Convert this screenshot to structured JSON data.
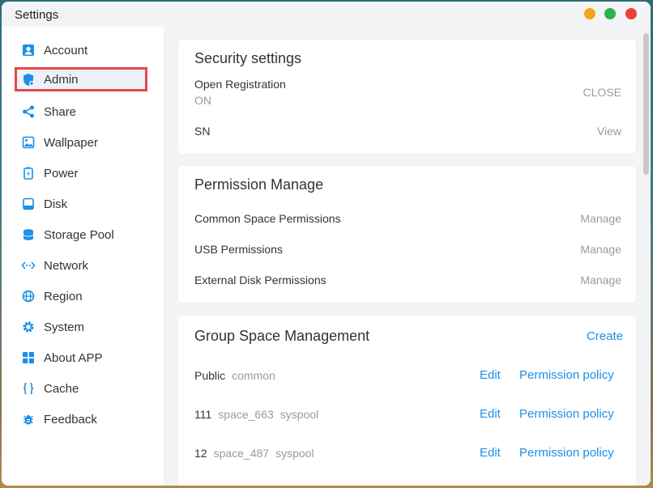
{
  "window": {
    "title": "Settings"
  },
  "accent_color": "#1a8fe6",
  "sidebar": {
    "items": [
      {
        "label": "Account",
        "icon": "account-icon"
      },
      {
        "label": "Admin",
        "icon": "admin-shield-icon",
        "active": true
      },
      {
        "label": "Share",
        "icon": "share-icon"
      },
      {
        "label": "Wallpaper",
        "icon": "wallpaper-icon"
      },
      {
        "label": "Power",
        "icon": "power-icon"
      },
      {
        "label": "Disk",
        "icon": "disk-icon"
      },
      {
        "label": "Storage Pool",
        "icon": "storage-pool-icon"
      },
      {
        "label": "Network",
        "icon": "network-icon"
      },
      {
        "label": "Region",
        "icon": "globe-icon"
      },
      {
        "label": "System",
        "icon": "gear-icon"
      },
      {
        "label": "About APP",
        "icon": "apps-grid-icon"
      },
      {
        "label": "Cache",
        "icon": "braces-icon"
      },
      {
        "label": "Feedback",
        "icon": "bug-icon"
      }
    ]
  },
  "security": {
    "title": "Security settings",
    "open_registration": {
      "label": "Open Registration",
      "value": "ON",
      "action": "CLOSE"
    },
    "sn": {
      "label": "SN",
      "action": "View"
    }
  },
  "permissions": {
    "title": "Permission Manage",
    "rows": [
      {
        "label": "Common Space Permissions",
        "action": "Manage"
      },
      {
        "label": "USB Permissions",
        "action": "Manage"
      },
      {
        "label": "External Disk Permissions",
        "action": "Manage"
      }
    ]
  },
  "groups": {
    "title": "Group Space Management",
    "create": "Create",
    "rows": [
      {
        "name": "Public",
        "space": "common",
        "pool": "",
        "edit": "Edit",
        "policy": "Permission policy"
      },
      {
        "name": "111",
        "space": "space_663",
        "pool": "syspool",
        "edit": "Edit",
        "policy": "Permission policy"
      },
      {
        "name": "12",
        "space": "space_487",
        "pool": "syspool",
        "edit": "Edit",
        "policy": "Permission policy"
      }
    ]
  }
}
